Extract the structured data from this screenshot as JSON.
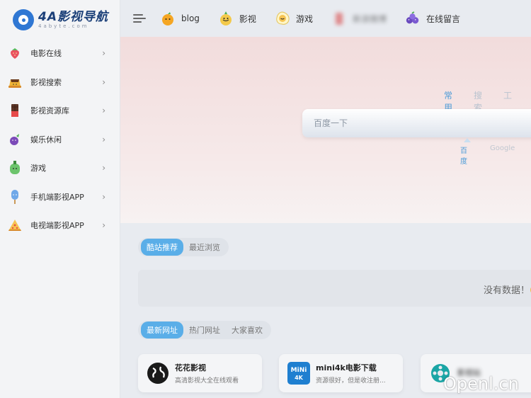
{
  "logo": {
    "title": "4A影视导航",
    "subtitle": "4abyte.com"
  },
  "sidebar": {
    "items": [
      {
        "label": "电影在线",
        "icon": "strawberry-icon"
      },
      {
        "label": "影视搜索",
        "icon": "pudding-icon"
      },
      {
        "label": "影视资源库",
        "icon": "chocolate-icon"
      },
      {
        "label": "娱乐休闲",
        "icon": "eggplant-icon"
      },
      {
        "label": "游戏",
        "icon": "pepper-icon"
      },
      {
        "label": "手机端影视APP",
        "icon": "popsicle-icon"
      },
      {
        "label": "电视端影视APP",
        "icon": "pizza-icon"
      }
    ]
  },
  "header": {
    "items": [
      {
        "label": "blog",
        "icon": "orange-icon"
      },
      {
        "label": "影视",
        "icon": "onion-icon"
      },
      {
        "label": "游戏",
        "icon": "egg-icon"
      },
      {
        "label": "新浪微博",
        "icon": "drink-icon"
      },
      {
        "label": "在线留言",
        "icon": "grapes-icon"
      }
    ]
  },
  "search": {
    "tabs": [
      "常用",
      "搜索",
      "工"
    ],
    "placeholder": "百度一下",
    "engines": [
      "百度",
      "Google"
    ]
  },
  "recommend": {
    "tabs": [
      "酷站推荐",
      "最近浏览"
    ],
    "empty_text": "没有数据！🙂"
  },
  "sites": {
    "tabs": [
      "最新网址",
      "热门网址",
      "大家喜欢"
    ],
    "cards": [
      {
        "title": "花花影视",
        "desc": "高清影视大全在线观看"
      },
      {
        "title": "mini4k电影下载",
        "desc": "资源很好，但是收注册..."
      },
      {
        "title": "影视站",
        "desc": ""
      }
    ]
  },
  "watermark": "Openl.cn",
  "colors": {
    "accent": "#5aaee8",
    "hero_top": "#f2dcdc",
    "sidebar_bg": "#f3f4f6"
  }
}
